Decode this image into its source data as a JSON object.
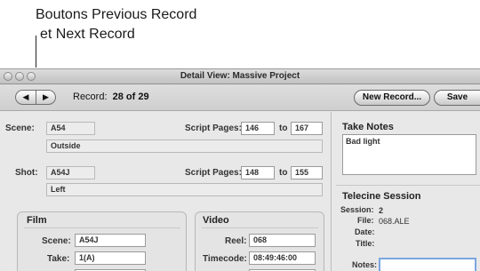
{
  "annotation": {
    "line1": "Boutons Previous Record",
    "line2": "et Next Record"
  },
  "window": {
    "title": "Detail View: Massive Project"
  },
  "toolbar": {
    "prev_glyph": "◀",
    "next_glyph": "▶",
    "record_label": "Record:",
    "record_value": "28 of 29",
    "new_record_label": "New Record...",
    "save_label": "Save"
  },
  "scene": {
    "label": "Scene:",
    "value": "A54",
    "description": "Outside",
    "script_pages_label": "Script Pages:",
    "pages_from": "146",
    "to_label": "to",
    "pages_to": "167"
  },
  "shot": {
    "label": "Shot:",
    "value": "A54J",
    "description": "Left",
    "script_pages_label": "Script Pages:",
    "pages_from": "148",
    "to_label": "to",
    "pages_to": "155"
  },
  "film": {
    "title": "Film",
    "scene_label": "Scene:",
    "scene_value": "A54J",
    "take_label": "Take:",
    "take_value": "1(A)"
  },
  "video": {
    "title": "Video",
    "reel_label": "Reel:",
    "reel_value": "068",
    "timecode_label": "Timecode:",
    "timecode_value": "08:49:46:00"
  },
  "take_notes": {
    "title": "Take Notes",
    "text": "Bad light"
  },
  "telecine": {
    "title": "Telecine Session",
    "session_label": "Session:",
    "session_value": "2",
    "file_label": "File:",
    "file_value": "068.ALE",
    "date_label": "Date:",
    "title_label": "Title:",
    "notes_label": "Notes:"
  }
}
